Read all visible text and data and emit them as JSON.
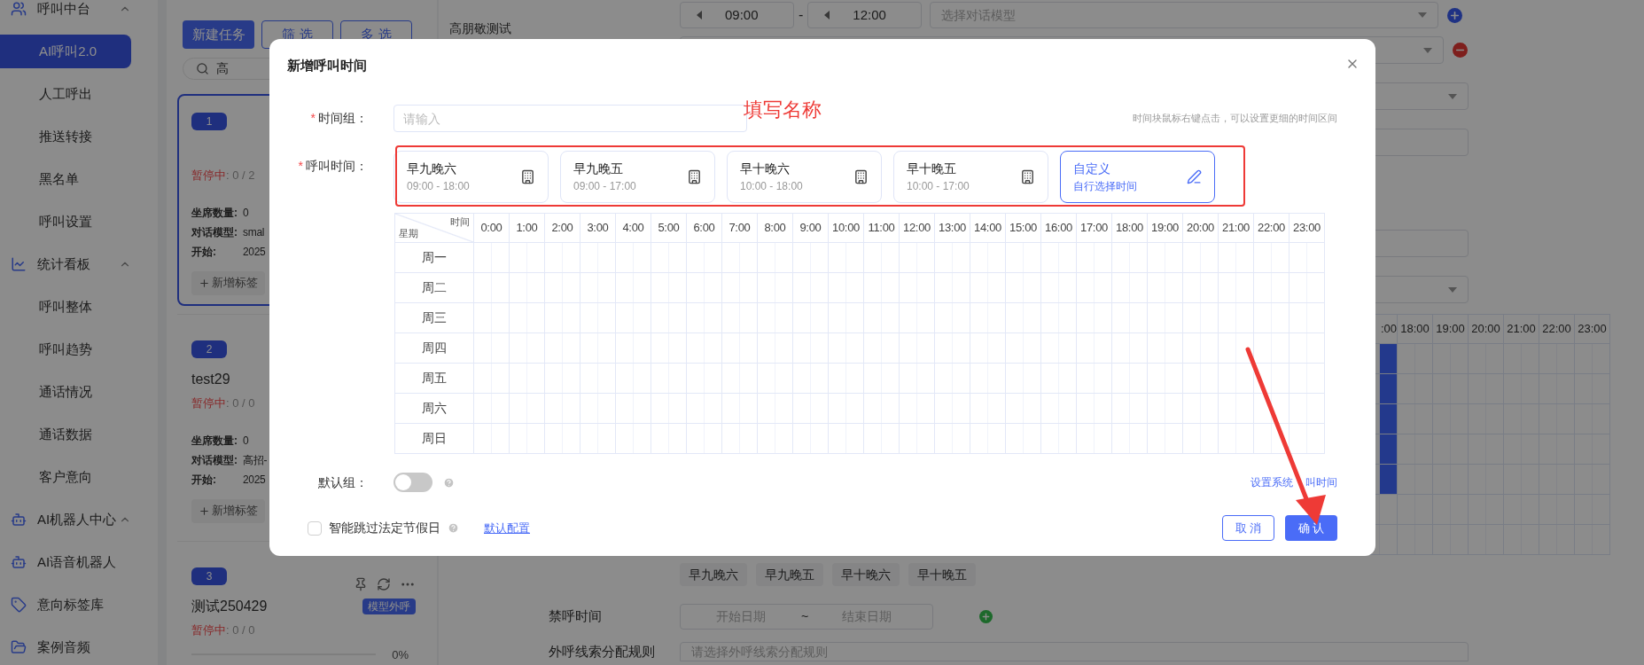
{
  "sidebar": {
    "items": [
      {
        "kind": "group",
        "label": "呼叫中台",
        "expanded": true
      },
      {
        "kind": "item",
        "label": "AI呼叫2.0",
        "selected": true
      },
      {
        "kind": "item",
        "label": "人工呼出",
        "selected": false
      },
      {
        "kind": "item",
        "label": "推送转接",
        "selected": false
      },
      {
        "kind": "item",
        "label": "黑名单",
        "selected": false
      },
      {
        "kind": "item",
        "label": "呼叫设置",
        "selected": false
      },
      {
        "kind": "group",
        "label": "统计看板",
        "expanded": true
      },
      {
        "kind": "item",
        "label": "呼叫整体",
        "selected": false
      },
      {
        "kind": "item",
        "label": "呼叫趋势",
        "selected": false
      },
      {
        "kind": "item",
        "label": "通话情况",
        "selected": false
      },
      {
        "kind": "item",
        "label": "通话数据",
        "selected": false
      },
      {
        "kind": "item",
        "label": "客户意向",
        "selected": false
      },
      {
        "kind": "group",
        "label": "AI机器人中心",
        "expanded": true
      },
      {
        "kind": "tool",
        "label": "AI语音机器人",
        "selected": false
      },
      {
        "kind": "tool",
        "label": "意向标签库",
        "selected": false
      },
      {
        "kind": "tool",
        "label": "案例音频",
        "selected": false
      }
    ]
  },
  "task_panel": {
    "buttons": [
      {
        "label": "新建任务",
        "kind": "primary"
      },
      {
        "label": "筛 选",
        "kind": "outline"
      },
      {
        "label": "多 选",
        "kind": "outline"
      }
    ],
    "search": {
      "value": "高"
    },
    "tasks": [
      {
        "index": "1",
        "selected": true,
        "status": "暂停中",
        "count": ": 0 / 2",
        "fields": [
          {
            "label": "坐席数量:",
            "value": "0"
          },
          {
            "label": "对话模型:",
            "value": "smal"
          },
          {
            "label": "开始:",
            "value": "2025"
          }
        ],
        "add_tag": "新增标签"
      },
      {
        "index": "2",
        "selected": false,
        "name": "test29",
        "status": "暂停中",
        "count": ": 0 / 0",
        "fields": [
          {
            "label": "坐席数量:",
            "value": "0"
          },
          {
            "label": "对话模型:",
            "value": "高招-"
          },
          {
            "label": "开始:",
            "value": "2025"
          }
        ],
        "add_tag": "新增标签"
      },
      {
        "index": "3",
        "selected": false,
        "name": "测试250429",
        "tag": "模型外呼",
        "status": "暂停中",
        "count": ": 0 / 0",
        "progress": "0%",
        "level": 0,
        "actions": true
      }
    ]
  },
  "detail_title": "高朋敬测试",
  "task_form": {
    "time_row": {
      "start": "09:00",
      "separator": "-",
      "end": "12:00",
      "model_placeholder": "选择对话模型"
    },
    "schedule_preview": {
      "hours": [
        ":00",
        "18:00",
        "19:00",
        "20:00",
        "21:00",
        "22:00",
        "23:00"
      ],
      "filled": [
        true,
        true,
        true,
        true,
        true,
        false,
        false
      ]
    },
    "presets": [
      "早九晚六",
      "早九晚五",
      "早十晚六",
      "早十晚五"
    ],
    "blocked_time": {
      "label": "禁呼时间",
      "start_placeholder": "开始日期",
      "separator": "~",
      "end_placeholder": "结束日期"
    },
    "allocation": {
      "label": "外呼线索分配规则",
      "placeholder": "请选择外呼线索分配规则"
    }
  },
  "dialog": {
    "title": "新增呼叫时间",
    "group_field": {
      "required_mark": "*",
      "label": "时间组：",
      "placeholder": "请输入"
    },
    "hint": "时间块鼠标右键点击，可以设置更细的时间区间",
    "call_time": {
      "required_mark": "*",
      "label": "呼叫时间：",
      "presets": [
        {
          "kind": "preset",
          "name": "早九晚六",
          "time": "09:00 - 18:00",
          "selected": false
        },
        {
          "kind": "preset",
          "name": "早九晚五",
          "time": "09:00 - 17:00",
          "selected": false
        },
        {
          "kind": "preset",
          "name": "早十晚六",
          "time": "10:00 - 18:00",
          "selected": false
        },
        {
          "kind": "preset",
          "name": "早十晚五",
          "time": "10:00 - 17:00",
          "selected": false
        },
        {
          "kind": "custom",
          "name": "自定义",
          "time": "自行选择时间",
          "selected": true
        }
      ]
    },
    "schedule": {
      "corner_top": "时间",
      "corner_bottom": "星期",
      "hours": [
        "0:00",
        "1:00",
        "2:00",
        "3:00",
        "4:00",
        "5:00",
        "6:00",
        "7:00",
        "8:00",
        "9:00",
        "10:00",
        "11:00",
        "12:00",
        "13:00",
        "14:00",
        "15:00",
        "16:00",
        "17:00",
        "18:00",
        "19:00",
        "20:00",
        "21:00",
        "22:00",
        "23:00"
      ],
      "days": [
        "周一",
        "周二",
        "周三",
        "周四",
        "周五",
        "周六",
        "周日"
      ]
    },
    "default_group": {
      "label": "默认组：",
      "on": false
    },
    "system_link": [
      "设置系统",
      "叫时间"
    ],
    "skip_holidays": {
      "label": "智能跳过法定节假日",
      "checked": false
    },
    "default_config_link": "默认配置",
    "buttons": [
      {
        "label": "取 消",
        "kind": "secondary"
      },
      {
        "label": "确 认",
        "kind": "primary"
      }
    ]
  },
  "annotation": {
    "note": "填写名称"
  }
}
